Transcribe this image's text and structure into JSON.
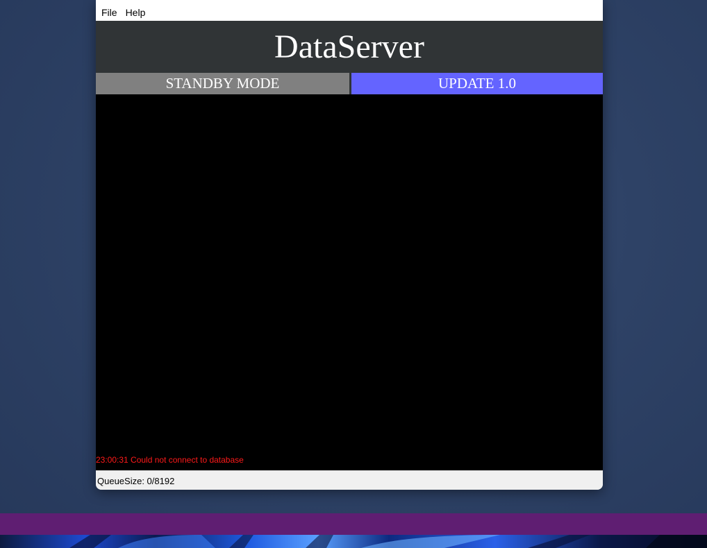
{
  "menu": {
    "file": "File",
    "help": "Help"
  },
  "banner": {
    "title": "DataServer"
  },
  "modes": {
    "standby": "STANDBY MODE",
    "update": "UPDATE 1.0"
  },
  "console": {
    "lines": [
      {
        "time": "23:00:31",
        "message": "Could not connect to database",
        "color": "#ff1a1a"
      }
    ],
    "line0_text": "23:00:31 Could not connect to database"
  },
  "status": {
    "queue": "QueueSize: 0/8192"
  },
  "colors": {
    "banner_bg": "#303436",
    "standby_bg": "#808080",
    "update_bg": "#6464ff",
    "console_bg": "#000000",
    "error_text": "#ff1a1a",
    "taskbar_purple": "#5f1e72"
  }
}
